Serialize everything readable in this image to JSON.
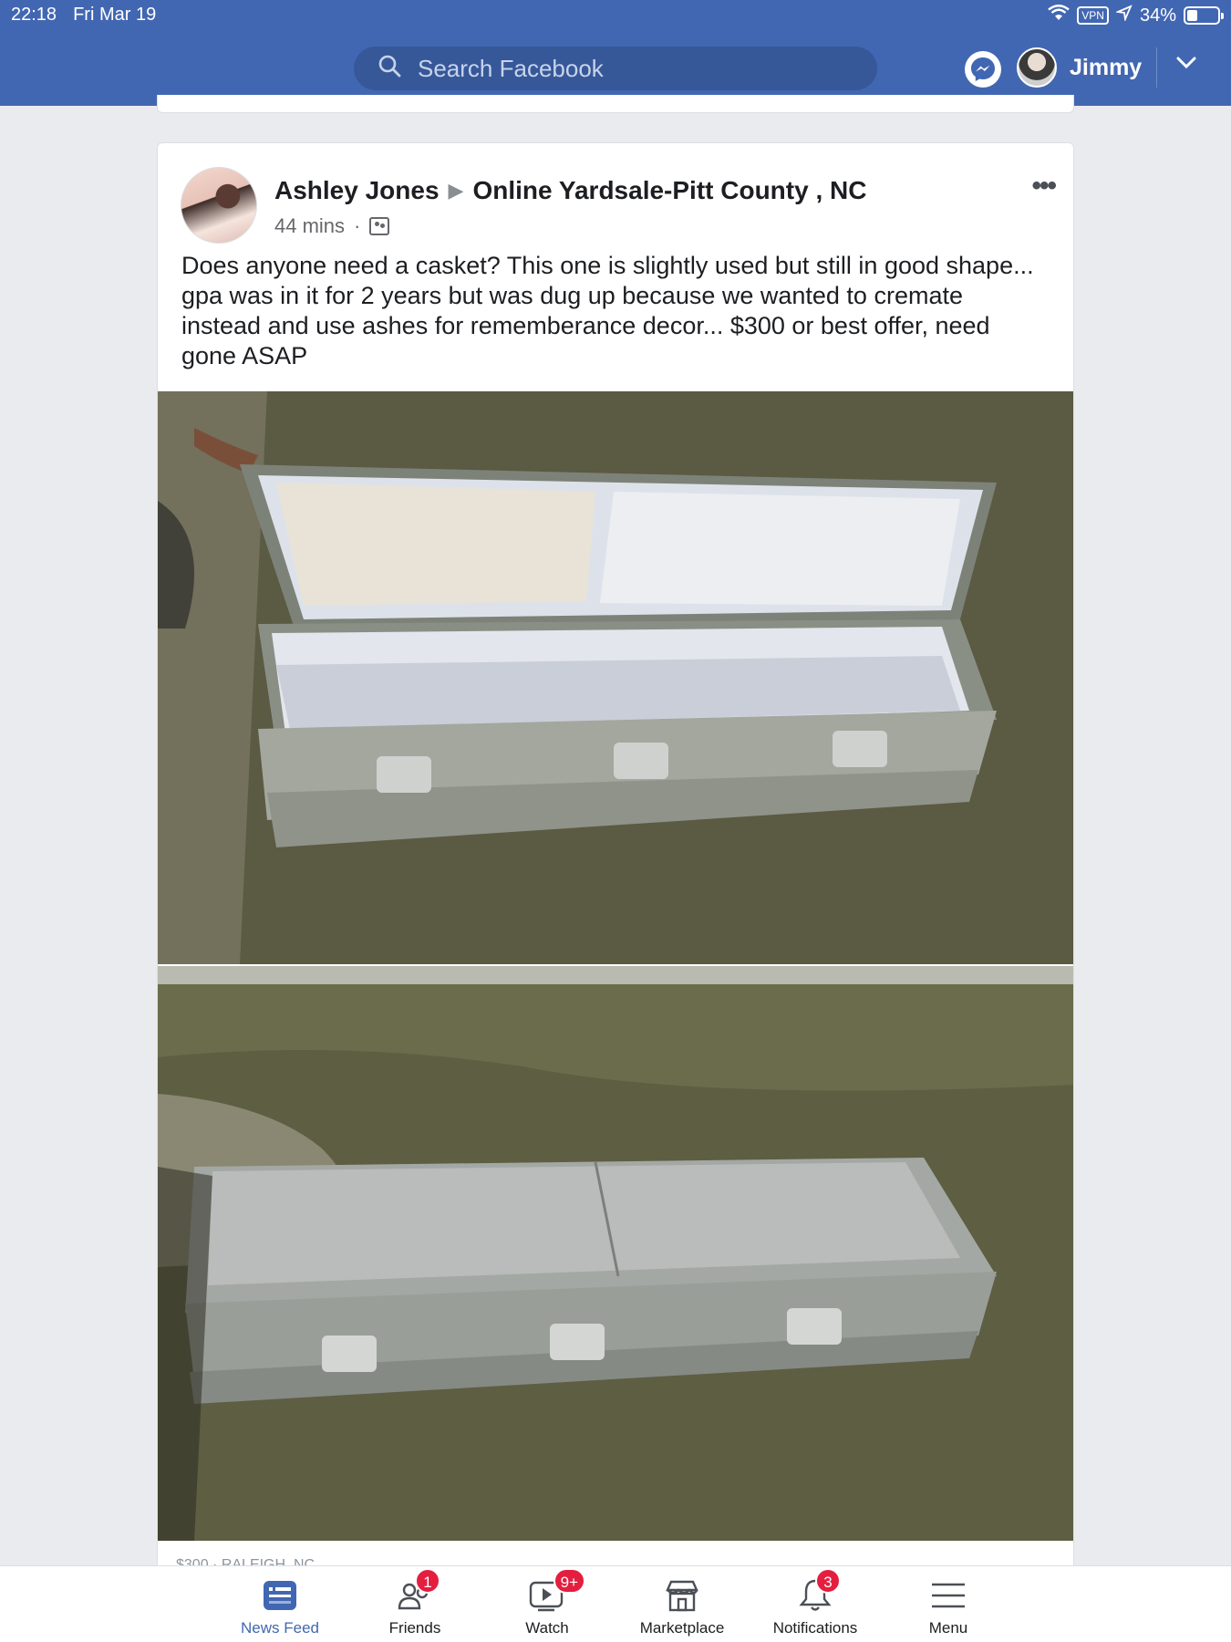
{
  "status_bar": {
    "time": "22:18",
    "date": "Fri Mar 19",
    "vpn": "VPN",
    "battery": "34%",
    "battery_level": 0.34
  },
  "header": {
    "search_placeholder": "Search Facebook",
    "user_name": "Jimmy",
    "brand_color": "#4267b2"
  },
  "post": {
    "author": "Ashley Jones",
    "group": "Online Yardsale-Pitt County , NC",
    "time": "44 mins",
    "separator": "·",
    "more": "•••",
    "text": "Does anyone need a casket? This one is slightly used but still in good shape... gpa was in it for 2 years but was dug up because we wanted to cremate instead and use ashes for rememberance decor... $300 or best offer, need gone ASAP",
    "photos": [
      "open-casket-photo",
      "closed-casket-photo"
    ],
    "listing_partial": "$300 · RALEIGH, NC"
  },
  "bottom_nav": {
    "items": [
      {
        "label": "News Feed",
        "icon": "news-feed-icon",
        "badge": ""
      },
      {
        "label": "Friends",
        "icon": "friends-icon",
        "badge": "1"
      },
      {
        "label": "Watch",
        "icon": "watch-icon",
        "badge": "9+"
      },
      {
        "label": "Marketplace",
        "icon": "marketplace-icon",
        "badge": ""
      },
      {
        "label": "Notifications",
        "icon": "bell-icon",
        "badge": "3"
      },
      {
        "label": "Menu",
        "icon": "menu-icon",
        "badge": ""
      }
    ]
  }
}
